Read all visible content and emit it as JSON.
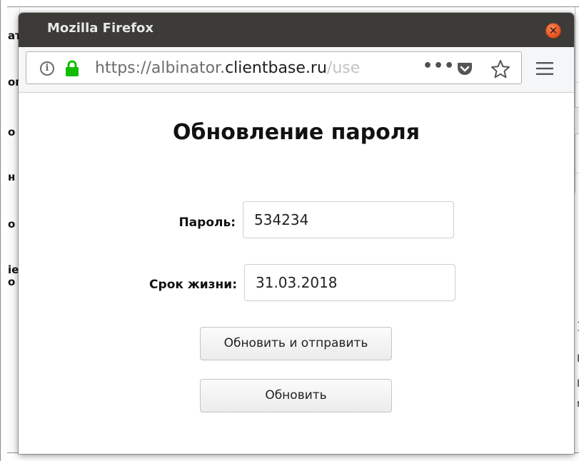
{
  "window": {
    "title": "Mozilla Firefox"
  },
  "navbar": {
    "url_scheme": "https://albinator.",
    "url_domain": "clientbase.ru",
    "url_path": "/use",
    "more_label": "•••"
  },
  "form": {
    "title": "Обновление пароля",
    "password_label": "Пароль:",
    "password_value": "534234",
    "lifetime_label": "Срок жизни:",
    "lifetime_value": "31.03.2018",
    "update_send_label": "Обновить и отправить",
    "update_label": "Обновить"
  },
  "background": {
    "left_fragments": [
      "ат",
      "ог",
      "о",
      "н",
      "о",
      "іе",
      "о"
    ],
    "right_fragments": [
      "]",
      "I",
      "I",
      "r"
    ]
  },
  "colors": {
    "titlebar": "#3c3b37",
    "close_button": "#e95420",
    "lock": "#12bc00"
  },
  "icons": {
    "info": "info-icon",
    "lock": "lock-icon",
    "more": "more-icon",
    "pocket": "pocket-icon",
    "star": "star-icon",
    "menu": "hamburger-menu-icon",
    "close": "close-icon"
  }
}
